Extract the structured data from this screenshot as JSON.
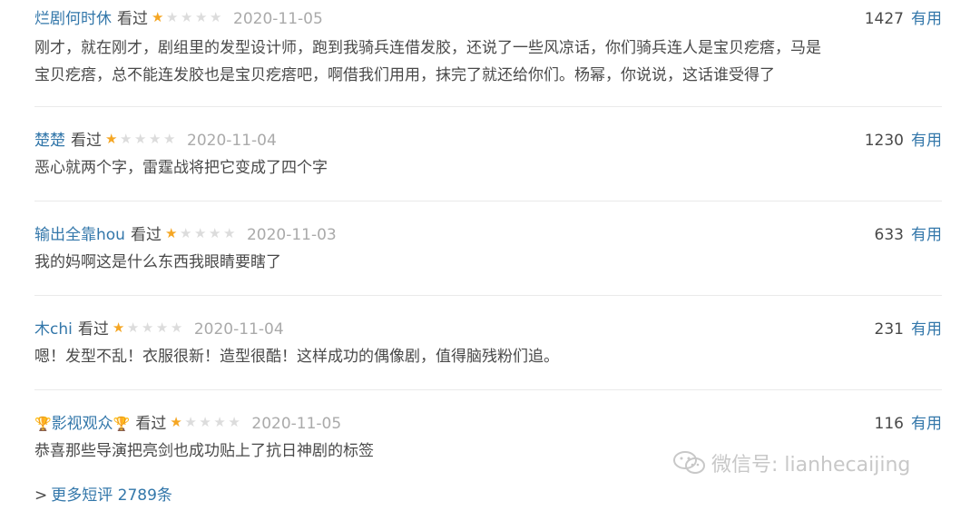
{
  "reviews": [
    {
      "user": "烂剧何时休",
      "status": "看过",
      "rating": 1,
      "date": "2020-11-05",
      "count": "1427",
      "useful": "有用",
      "text_lines": [
        "刚才，就在刚才，剧组里的发型设计师，跑到我骑兵连借发胶，还说了一些风凉话，你们骑兵连人是宝贝疙瘩，马是",
        "宝贝疙瘩，总不能连发胶也是宝贝疙瘩吧，啊借我们用用，抹完了就还给你们。杨幂，你说说，这话谁受得了"
      ]
    },
    {
      "user": "楚楚",
      "status": "看过",
      "rating": 1,
      "date": "2020-11-04",
      "count": "1230",
      "useful": "有用",
      "text_lines": [
        "恶心就两个字，雷霆战将把它变成了四个字"
      ]
    },
    {
      "user": "输出全靠hou",
      "status": "看过",
      "rating": 1,
      "date": "2020-11-03",
      "count": "633",
      "useful": "有用",
      "text_lines": [
        "我的妈啊这是什么东西我眼睛要瞎了"
      ]
    },
    {
      "user": "木chi",
      "status": "看过",
      "rating": 1,
      "date": "2020-11-04",
      "count": "231",
      "useful": "有用",
      "text_lines": [
        "嗯！发型不乱！衣服很新！造型很酷！这样成功的偶像剧，值得脑残粉们追。"
      ]
    },
    {
      "user": "影视观众",
      "status": "看过",
      "rating": 1,
      "date": "2020-11-05",
      "count": "116",
      "useful": "有用",
      "text_lines": [
        "恭喜那些导演把亮剑也成功贴上了抗日神剧的标签"
      ]
    }
  ],
  "more_link": "更多短评 2789条",
  "more_arrow": ">",
  "watermark": "微信号: lianhecaijing",
  "colors": {
    "link": "#3377aa",
    "star_on": "#f5a623",
    "star_off": "#dcdcdc",
    "date": "#aaaaaa",
    "text": "#494949"
  }
}
